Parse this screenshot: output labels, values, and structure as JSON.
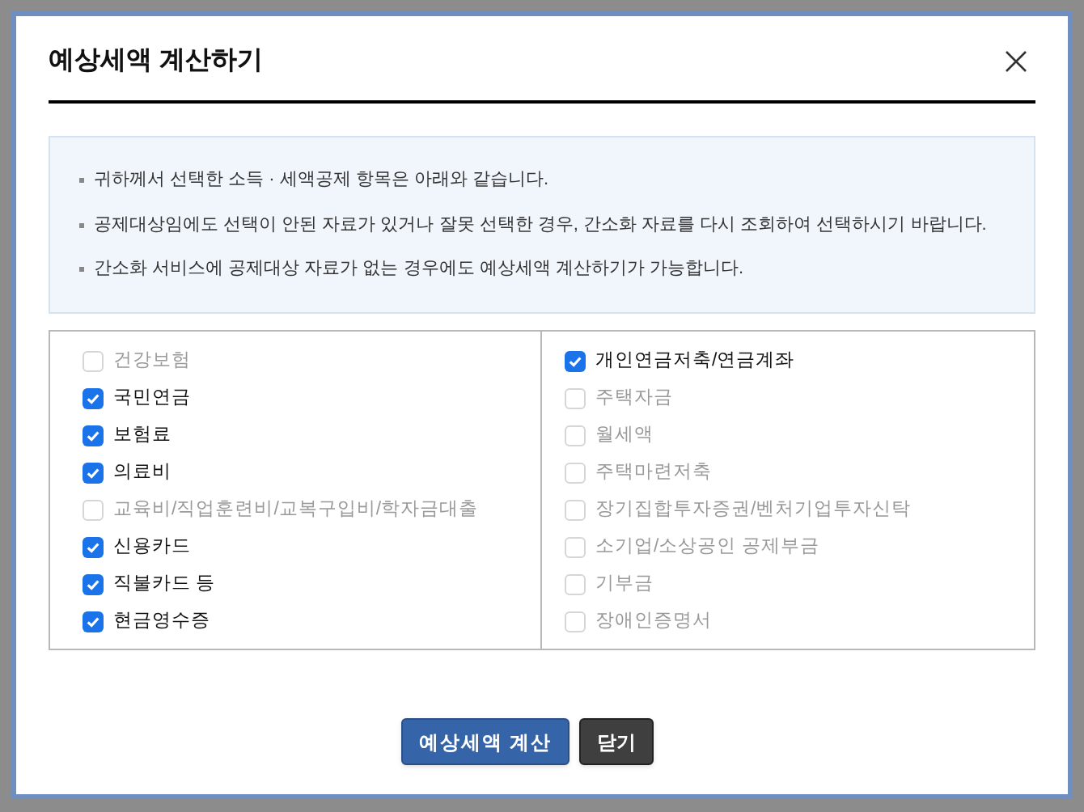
{
  "dialog": {
    "title": "예상세액 계산하기"
  },
  "notices": [
    "귀하께서 선택한 소득 · 세액공제 항목은 아래와 같습니다.",
    "공제대상임에도 선택이 안된 자료가 있거나 잘못 선택한 경우, 간소화 자료를 다시 조회하여 선택하시기 바랍니다.",
    "간소화 서비스에 공제대상 자료가 없는 경우에도 예상세액 계산하기가 가능합니다."
  ],
  "columns": [
    [
      {
        "label": "건강보험",
        "checked": false
      },
      {
        "label": "국민연금",
        "checked": true
      },
      {
        "label": "보험료",
        "checked": true
      },
      {
        "label": "의료비",
        "checked": true
      },
      {
        "label": "교육비/직업훈련비/교복구입비/학자금대출",
        "checked": false
      },
      {
        "label": "신용카드",
        "checked": true
      },
      {
        "label": "직불카드 등",
        "checked": true
      },
      {
        "label": "현금영수증",
        "checked": true
      }
    ],
    [
      {
        "label": "개인연금저축/연금계좌",
        "checked": true
      },
      {
        "label": "주택자금",
        "checked": false
      },
      {
        "label": "월세액",
        "checked": false
      },
      {
        "label": "주택마련저축",
        "checked": false
      },
      {
        "label": "장기집합투자증권/벤처기업투자신탁",
        "checked": false
      },
      {
        "label": "소기업/소상공인 공제부금",
        "checked": false
      },
      {
        "label": "기부금",
        "checked": false
      },
      {
        "label": "장애인증명서",
        "checked": false
      }
    ]
  ],
  "buttons": [
    {
      "label": "예상세액 계산",
      "kind": "primary"
    },
    {
      "label": "닫기",
      "kind": "secondary"
    }
  ]
}
